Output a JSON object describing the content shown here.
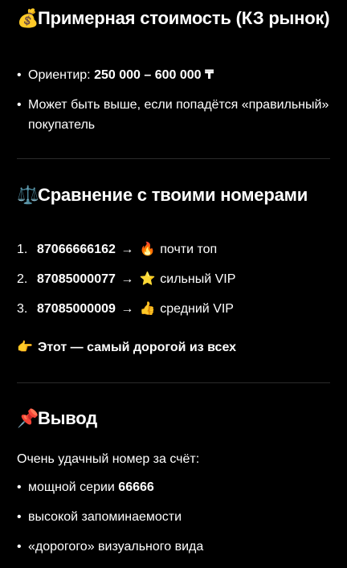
{
  "section_price": {
    "icon": "money-bag-icon",
    "icon_glyph": "💰",
    "title": "Примерная стоимость (КЗ рынок)",
    "bullet_1_prefix": "Ориентир: ",
    "bullet_1_value": "250 000 – 600 000 ₸",
    "bullet_2": "Может быть выше, если попадётся «правильный» покупатель"
  },
  "section_compare": {
    "icon": "scales-icon",
    "icon_glyph": "⚖️",
    "title": "Сравнение с твоими номерами",
    "items": [
      {
        "num": "1.",
        "phone": "87066666162",
        "arrow": "→",
        "icon": "fire-icon",
        "icon_glyph": "🔥",
        "label": "почти топ"
      },
      {
        "num": "2.",
        "phone": "87085000077",
        "arrow": "→",
        "icon": "star-icon",
        "icon_glyph": "⭐",
        "label": "сильный VIP"
      },
      {
        "num": "3.",
        "phone": "87085000009",
        "arrow": "→",
        "icon": "thumbs-up-icon",
        "icon_glyph": "👍",
        "label": "средний VIP"
      }
    ],
    "note_icon": "pointing-hand-icon",
    "note_icon_glyph": "👉",
    "note": "Этот — самый дорогой из всех"
  },
  "section_conclusion": {
    "icon": "pushpin-icon",
    "icon_glyph": "📌",
    "title": "Вывод",
    "intro": "Очень удачный номер за счёт:",
    "bullet_1_prefix": "мощной серии ",
    "bullet_1_value": "66666",
    "bullet_2": "высокой запоминаемости",
    "bullet_3": "«дорогого» визуального вида"
  },
  "colors": {
    "background": "#000000",
    "text": "#ffffff",
    "divider": "#2a2a2a"
  }
}
